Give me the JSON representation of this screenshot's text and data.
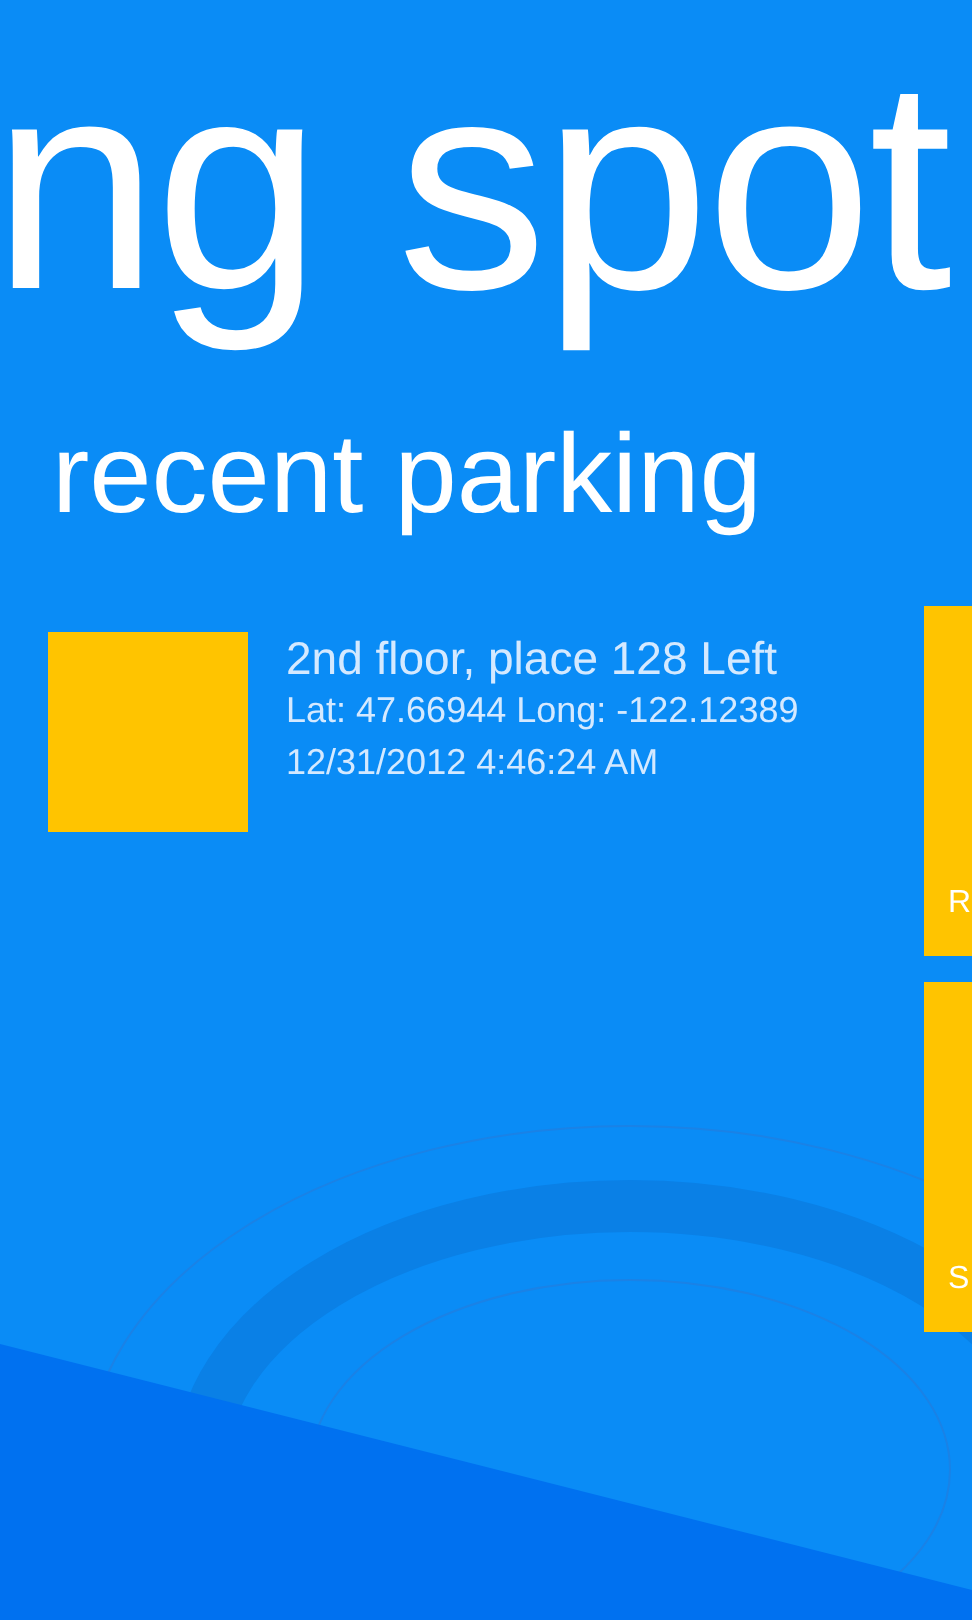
{
  "panorama_title": "ng spot",
  "section": {
    "heading": "recent parking",
    "items": [
      {
        "title": "2nd floor, place 128 Left",
        "location": "Lat: 47.66944 Long: -122.12389",
        "time": "12/31/2012 4:46:24 AM"
      }
    ]
  },
  "tiles": [
    {
      "label": "R"
    },
    {
      "label": "S"
    }
  ]
}
